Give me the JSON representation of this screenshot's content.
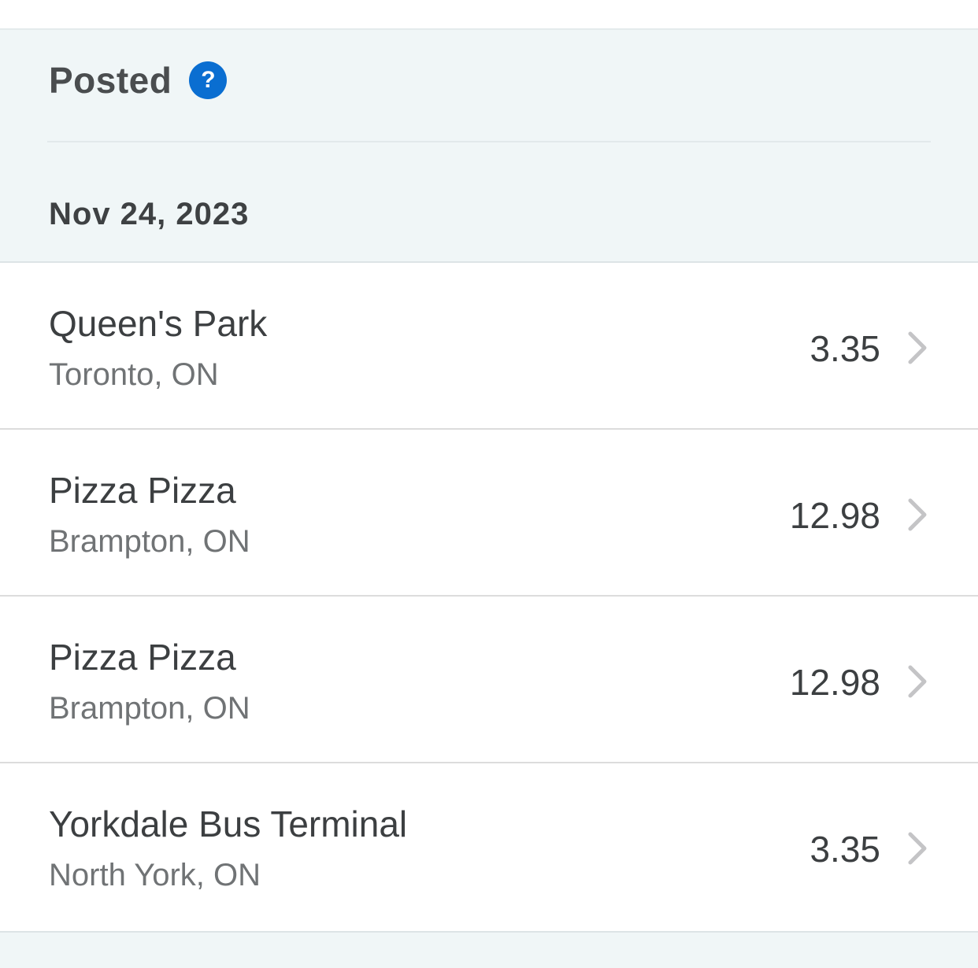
{
  "section": {
    "title": "Posted",
    "help_icon_glyph": "?",
    "help_icon_color": "#0a6ed1",
    "date": "Nov 24, 2023"
  },
  "transactions": [
    {
      "merchant": "Queen's Park",
      "location": "Toronto, ON",
      "amount": "3.35"
    },
    {
      "merchant": "Pizza Pizza",
      "location": "Brampton, ON",
      "amount": "12.98"
    },
    {
      "merchant": "Pizza Pizza",
      "location": "Brampton, ON",
      "amount": "12.98"
    },
    {
      "merchant": "Yorkdale Bus Terminal",
      "location": "North York, ON",
      "amount": "3.35"
    }
  ],
  "icons": {
    "help": "help-icon",
    "row_disclosure": "chevron-right-icon"
  }
}
